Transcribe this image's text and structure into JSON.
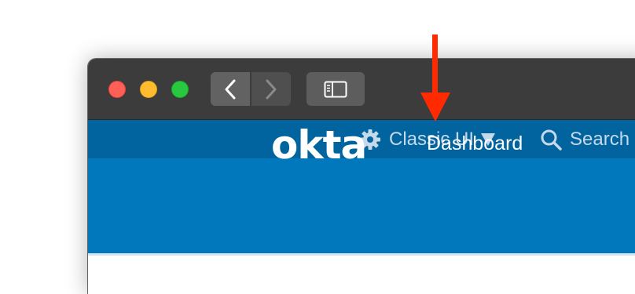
{
  "browser": {
    "back_icon": "chevron-left-icon",
    "forward_icon": "chevron-right-icon",
    "sidebar_icon": "sidebar-icon"
  },
  "topbar": {
    "classic_ui_label": "Classic UI",
    "classic_ui_icon": "gear-icon",
    "classic_ui_caret": "caret-down-icon",
    "search_label": "Search",
    "search_icon": "search-icon"
  },
  "header": {
    "logo_text": "okta",
    "dashboard_label": "Dashboard"
  },
  "colors": {
    "topbar_bg": "#02649f",
    "header_bg": "#0177bc",
    "annotation_arrow": "#ff2a00"
  }
}
